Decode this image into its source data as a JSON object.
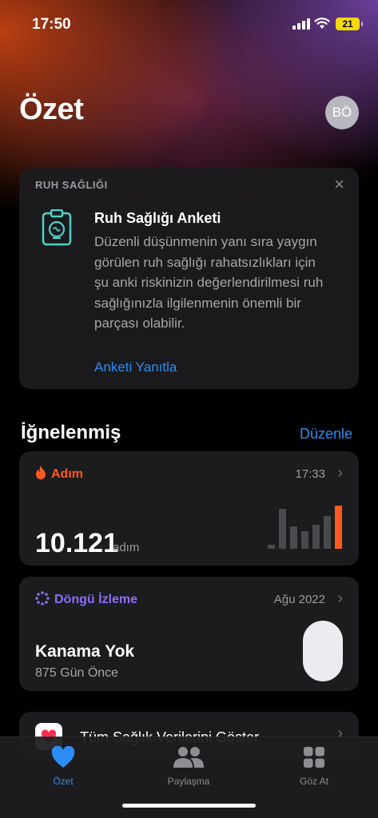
{
  "status_bar": {
    "time": "17:50",
    "battery": "21"
  },
  "header": {
    "title": "Özet",
    "avatar_initials": "BÖ"
  },
  "survey_card": {
    "section": "RUH SAĞLIĞI",
    "close_icon": "close-icon",
    "title": "Ruh Sağlığı Anketi",
    "body": "Düzenli düşünmenin yanı sıra yaygın görülen ruh sağlığı rahatsızlıkları için şu anki riskinizin değerlendirilmesi ruh sağlığınızla ilgilenmenin önemli bir parçası olabilir.",
    "link": "Anketi Yanıtla"
  },
  "pinned": {
    "title": "İğnelenmiş",
    "edit": "Düzenle",
    "steps": {
      "label": "Adım",
      "time": "17:33",
      "value": "10.121",
      "unit": "adım",
      "accent": "#ff5a1f"
    },
    "cycle": {
      "label": "Döngü İzleme",
      "date": "Ağu 2022",
      "status": "Kanama Yok",
      "detail": "875 Gün Önce",
      "accent": "#8d6cff"
    }
  },
  "all_data": {
    "label": "Tüm Sağlık Verilerini Göster"
  },
  "tabs": [
    {
      "label": "Özet",
      "icon": "heart-icon",
      "active": true
    },
    {
      "label": "Paylaşma",
      "icon": "people-icon",
      "active": false
    },
    {
      "label": "Göz At",
      "icon": "grid-icon",
      "active": false
    }
  ]
}
